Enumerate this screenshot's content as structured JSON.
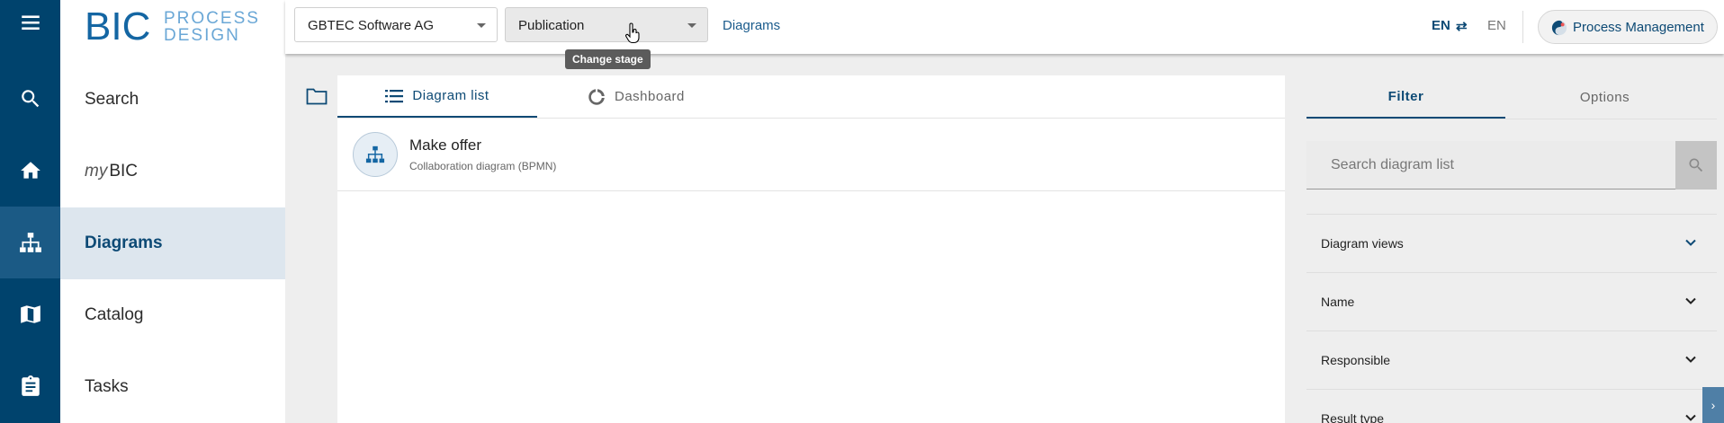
{
  "rail": {
    "items": [
      "menu-icon",
      "search-icon",
      "home-icon",
      "diagrams-icon",
      "catalog-icon",
      "tasks-icon"
    ]
  },
  "logo": {
    "bic": "BIC",
    "line1": "PROCESS",
    "line2": "DESIGN"
  },
  "nav": {
    "search": "Search",
    "mybic_prefix": "my",
    "mybic_suffix": "BIC",
    "diagrams": "Diagrams",
    "catalog": "Catalog",
    "tasks": "Tasks"
  },
  "topbar": {
    "company": "GBTEC Software AG",
    "stage": "Publication",
    "stage_tooltip": "Change stage",
    "breadcrumb": "Diagrams",
    "lang_from": "EN",
    "swap_glyph": "⇄",
    "lang_to": "EN",
    "module": "Process Management"
  },
  "main": {
    "tabs": [
      {
        "label": "Diagram list"
      },
      {
        "label": "Dashboard"
      }
    ],
    "rows": [
      {
        "title": "Make offer",
        "subtitle": "Collaboration diagram (BPMN)"
      }
    ]
  },
  "panel": {
    "tabs": {
      "filter": "Filter",
      "options": "Options"
    },
    "search_placeholder": "Search diagram list",
    "sections": [
      "Diagram views",
      "Name",
      "Responsible",
      "Result type"
    ],
    "edge_glyph": "›"
  },
  "colors": {
    "primary": "#00436d",
    "accent": "#0d4a75",
    "nav_active": "#dde6ee"
  }
}
